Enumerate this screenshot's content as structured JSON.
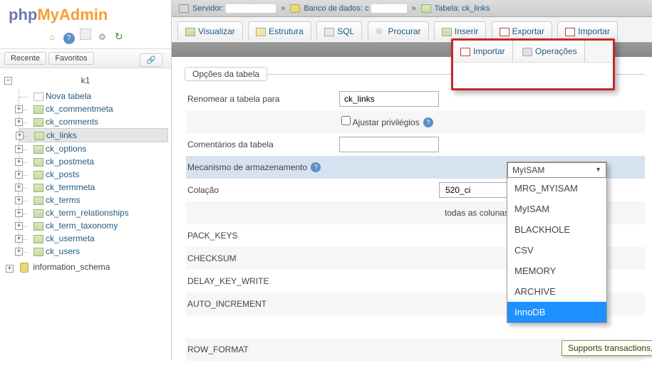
{
  "logo": {
    "part1": "php",
    "part2": "MyAdmin"
  },
  "sidebar": {
    "recent": "Recente",
    "favorites": "Favoritos",
    "db": "k1",
    "new_table": "Nova tabela",
    "tables": [
      "ck_commentmeta",
      "ck_comments",
      "ck_links",
      "ck_options",
      "ck_postmeta",
      "ck_posts",
      "ck_termmeta",
      "ck_terms",
      "ck_term_relationships",
      "ck_term_taxonomy",
      "ck_usermeta",
      "ck_users"
    ],
    "db2": "information_schema",
    "selected_table": "ck_links"
  },
  "breadcrumb": {
    "server_label": "Servidor:",
    "db_label": "Banco de dados: c",
    "table_label": "Tabela: ck_links"
  },
  "topmenu": {
    "browse": "Visualizar",
    "structure": "Estrutura",
    "sql": "SQL",
    "search": "Procurar",
    "insert": "Inserir",
    "export": "Exportar",
    "import": "Importar"
  },
  "popup": {
    "import": "Importar",
    "operations": "Operações"
  },
  "form": {
    "title": "Opções da tabela",
    "rename_label": "Renomear a tabela para",
    "rename_value": "ck_links",
    "adjust_priv": "Ajustar privilégios",
    "comments_label": "Comentários da tabela",
    "comments_value": "",
    "engine_label": "Mecanismo de armazenamento",
    "engine_value": "MyISAM",
    "collation_label": "Colação",
    "collation_value_suffix": "520_ci",
    "all_cols": "todas as colunas",
    "pack_keys": "PACK_KEYS",
    "checksum": "CHECKSUM",
    "delay_key_write": "DELAY_KEY_WRITE",
    "auto_increment": "AUTO_INCREMENT",
    "row_format": "ROW_FORMAT"
  },
  "dropdown": {
    "selected": "MyISAM",
    "options": [
      "MRG_MYISAM",
      "MyISAM",
      "BLACKHOLE",
      "CSV",
      "MEMORY",
      "ARCHIVE",
      "InnoDB"
    ],
    "highlighted": "InnoDB"
  },
  "tooltip": "Supports transactions, row-level locking, and foreign keys"
}
